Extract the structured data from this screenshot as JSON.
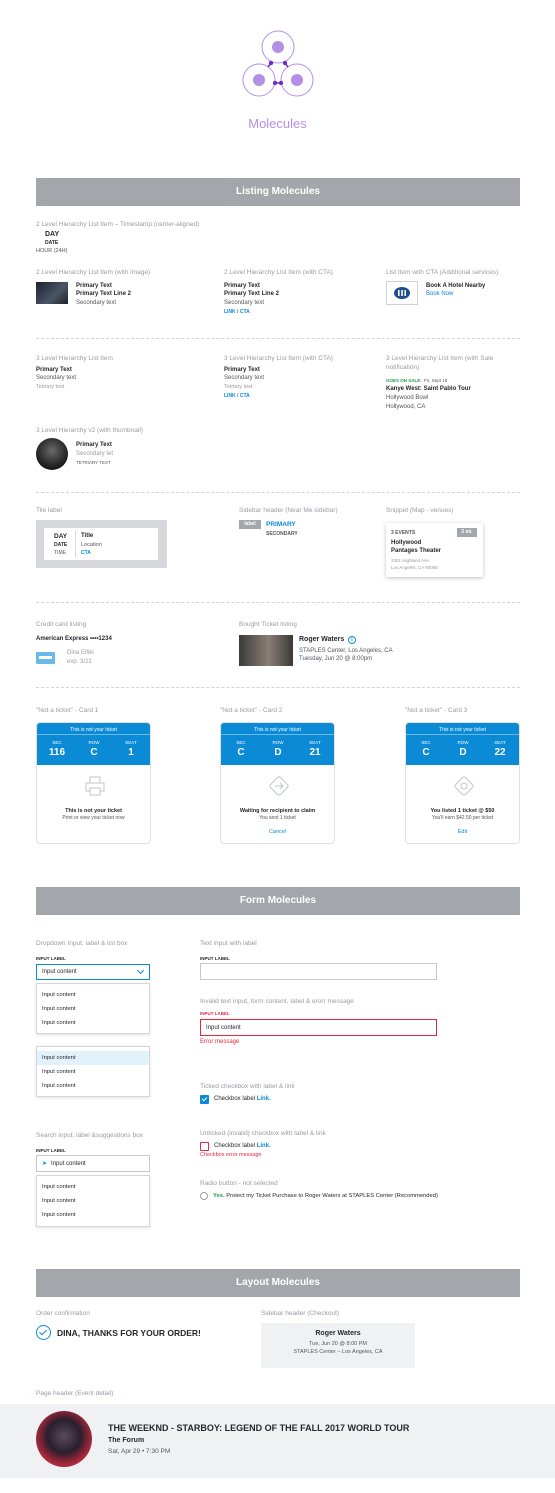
{
  "header": {
    "title": "Molecules"
  },
  "colors": {
    "accent": "#b48fe6",
    "link": "#0b8ad6",
    "error": "#e5293b",
    "bar": "#a3a7ab",
    "onsale": "#1e9b43"
  },
  "listing": {
    "bar": "Listing Molecules",
    "timestamp": {
      "label": "2 Level Hierarchy List Item – Timestamp (center-aligned)",
      "day": "DAY",
      "date": "DATE",
      "hour": "HOUR (24H)"
    },
    "with_image": {
      "label": "2 Level Hierarchy List Item (with image)",
      "p1": "Primary Text",
      "p2": "Primary Text Line 2",
      "s": "Secondary text"
    },
    "with_cta": {
      "label": "2 Level Hierarchy List Item (with CTA)",
      "p1": "Primary Text",
      "p2": "Primary Text Line 2",
      "s": "Secondary text",
      "cta": "LINK / CTA"
    },
    "addl": {
      "label": "List Item with CTA (Additional services)",
      "title": "Book A Hotel Nearby",
      "cta": "Book Now"
    },
    "l3": {
      "label": "3 Level Hierarchy List Item",
      "p": "Primary Text",
      "s": "Secondary text",
      "t": "Tetriary text"
    },
    "l3cta": {
      "label": "3 Level Hierarchy List Item (with CTA)",
      "p": "Primary Text",
      "s": "Secondary text",
      "t": "Tetriary text",
      "cta": "LINK / CTA"
    },
    "l3sale": {
      "label": "3 Level Hierarchy List Item (with Sale",
      "label2": "notification)",
      "onsale": "GOES ON SALE:",
      "date": "Fri, Sept 18",
      "title": "Kanye West: Saint Pablo Tour",
      "venue": "Hollywood Bowl",
      "city": "Hollywood, CA"
    },
    "l3v2": {
      "label": "3 Level Hierarchy v2 (with thumbnail)",
      "p": "Primary Text",
      "s": "Secondary tet",
      "t": "TETRIARY TEXT"
    },
    "tile": {
      "label": "Tile label",
      "day": "DAY",
      "date": "DATE",
      "time": "TIME",
      "title": "Title",
      "loc": "Location",
      "cta": "CTA"
    },
    "sidebar": {
      "label": "Sidebar header (Near Me sidebar)",
      "tag": "label",
      "primary": "PRIMARY",
      "secondary": "SECONDARY"
    },
    "snippet": {
      "label": "Snippet (Map - venues)",
      "events": "3 EVENTS",
      "dist": "3 mi.",
      "v1": "Hollywood",
      "v2": "Pantages Theater",
      "a1": "2301 Highland Ave.",
      "a2": "Los Angeles, CA 90068"
    },
    "cc": {
      "label": "Credit card listing",
      "card": "American Express ••••1234",
      "name": "Dina Elfiki",
      "exp": "exp. 3/21"
    },
    "bought": {
      "label": "Bought Ticket listing",
      "title": "Roger Waters",
      "venue": "STAPLES Center, Los Angeles, CA",
      "date": "Tuesday, Jun 20 @ 8:00pm"
    },
    "cards": [
      {
        "label": "\"Not a ticket\" - Card 1",
        "cap": "This is not your ticket",
        "sec": "116",
        "row": "C",
        "seat": "1",
        "m1": "This is not your ticket",
        "m2": "Print or view your ticket now",
        "m3": ""
      },
      {
        "label": "\"Not a ticket\" - Card 2",
        "cap": "This is not your ticket",
        "sec": "C",
        "row": "D",
        "seat": "21",
        "m1": "Waiting for recipient to claim",
        "m2": "You sent 1 ticket",
        "m3": "Cancel"
      },
      {
        "label": "\"Not a ticket\" - Card 3",
        "cap": "This is not your ticket",
        "sec": "C",
        "row": "D",
        "seat": "22",
        "m1": "You listed 1 ticket @ $50",
        "m2": "You'll earn $42.50 per ticket",
        "m3": "Edit"
      }
    ],
    "card_keys": {
      "sec": "SEC",
      "row": "ROW",
      "seat": "SEAT"
    }
  },
  "form": {
    "bar": "Form Molecules",
    "dropdown": {
      "label": "Dropdown Input, label & list box",
      "flabel": "INPUT LABEL",
      "value": "Input content",
      "items": [
        "Input content",
        "Input content",
        "Input content"
      ],
      "items2": [
        "Input content",
        "Input content",
        "Input content"
      ]
    },
    "text": {
      "label": "Text input with label",
      "flabel": "INPUT LABEL"
    },
    "invalid": {
      "label": "Invalid text input, form content, label & erorr message",
      "flabel": "INPUT LABEL",
      "value": "Input content",
      "error": "Error message"
    },
    "ticked": {
      "label": "Ticked checkbox with label & link",
      "text": "Checkbox label",
      "link": "Link."
    },
    "search": {
      "label": "Search input, label &suggestions box",
      "flabel": "INPUT LABEL",
      "value": "Input content",
      "items": [
        "Input content",
        "Input content",
        "Input content"
      ]
    },
    "unticked": {
      "label": "Unticked (invalid) checkbox with label & link",
      "text": "Checkbox label",
      "link": "Link.",
      "error": "Checkbox error message"
    },
    "radio": {
      "label": "Radio button - not selected",
      "yes": "Yes.",
      "text": "Protect my Ticket Purchase to Roger Waters at STAPLES Center (Recommended)"
    }
  },
  "layout": {
    "bar": "Layout Molecules",
    "order": {
      "label": "Order confirmation",
      "text": "DINA, THANKS FOR YOUR ORDER!"
    },
    "sidebar": {
      "label": "Sidebar header (Checkout)",
      "title": "Roger Waters",
      "date": "Tue, Jun 20 @ 8:00 PM",
      "venue": "STAPLES Center – Los Angeles, CA"
    },
    "page": {
      "label": "Page header (Event detail)",
      "title": "THE WEEKND - STARBOY: LEGEND OF THE FALL 2017 WORLD TOUR",
      "venue": "The Forum",
      "date": "Sat, Apr 29 • 7:30 PM"
    }
  }
}
